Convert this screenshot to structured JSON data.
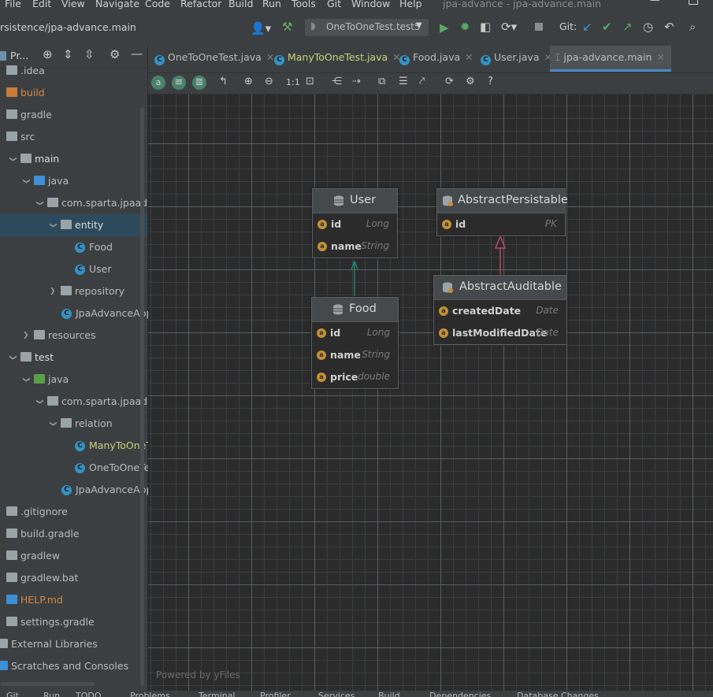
{
  "menu": {
    "items": [
      "File",
      "Edit",
      "View",
      "Navigate",
      "Code",
      "Refactor",
      "Build",
      "Run",
      "Tools",
      "Git",
      "Window",
      "Help"
    ],
    "window_title": "jpa-advance - jpa-advance.main"
  },
  "toolbar": {
    "breadcrumb": "rsistence/jpa-advance.main",
    "run_config": "OneToOneTest.test5",
    "git_label": "Git:"
  },
  "project": {
    "header": "Pr...",
    "tree": [
      {
        "label": ".idea",
        "kind": "folder-gray"
      },
      {
        "label": "build",
        "kind": "folder-orange"
      },
      {
        "label": "gradle",
        "kind": "folder-gray"
      },
      {
        "label": "src",
        "kind": "folder-gray"
      },
      {
        "label": "main",
        "kind": "folder-module"
      },
      {
        "label": "java",
        "kind": "folder-blue"
      },
      {
        "label": "com.sparta.jpaadvan",
        "kind": "package"
      },
      {
        "label": "entity",
        "kind": "package"
      },
      {
        "label": "Food",
        "kind": "class"
      },
      {
        "label": "User",
        "kind": "class"
      },
      {
        "label": "repository",
        "kind": "package"
      },
      {
        "label": "JpaAdvanceAppli",
        "kind": "app"
      },
      {
        "label": "resources",
        "kind": "folder-res"
      },
      {
        "label": "test",
        "kind": "folder-module"
      },
      {
        "label": "java",
        "kind": "folder-green"
      },
      {
        "label": "com.sparta.jpaadvan",
        "kind": "package"
      },
      {
        "label": "relation",
        "kind": "package"
      },
      {
        "label": "ManyToOneTe",
        "kind": "class-test"
      },
      {
        "label": "OneToOneTes",
        "kind": "class-test2"
      },
      {
        "label": "JpaAdvanceAppli",
        "kind": "app"
      },
      {
        "label": ".gitignore",
        "kind": "file"
      },
      {
        "label": "build.gradle",
        "kind": "gradle"
      },
      {
        "label": "gradlew",
        "kind": "file"
      },
      {
        "label": "gradlew.bat",
        "kind": "file"
      },
      {
        "label": "HELP.md",
        "kind": "md"
      },
      {
        "label": "settings.gradle",
        "kind": "gradle"
      },
      {
        "label": "External Libraries",
        "kind": "lib"
      },
      {
        "label": "Scratches and Consoles",
        "kind": "scratch"
      }
    ]
  },
  "tabs": [
    {
      "label": "OneToOneTest.java",
      "color": "#bbbbbb"
    },
    {
      "label": "ManyToOneTest.java",
      "color": "#c7d17a"
    },
    {
      "label": "Food.java",
      "color": "#bbbbbb"
    },
    {
      "label": "User.java",
      "color": "#bbbbbb"
    },
    {
      "label": "jpa-advance.main",
      "color": "#bbbbbb"
    }
  ],
  "diagram": {
    "nodes": {
      "user": {
        "title": "User",
        "fields": [
          {
            "name": "id",
            "type": "Long"
          },
          {
            "name": "name",
            "type": "String"
          }
        ]
      },
      "food": {
        "title": "Food",
        "fields": [
          {
            "name": "id",
            "type": "Long"
          },
          {
            "name": "name",
            "type": "String"
          },
          {
            "name": "price",
            "type": "double"
          }
        ]
      },
      "abstract_persistable": {
        "title": "AbstractPersistable",
        "fields": [
          {
            "name": "id",
            "type": "PK"
          }
        ]
      },
      "abstract_auditable": {
        "title": "AbstractAuditable",
        "fields": [
          {
            "name": "createdDate",
            "type": "Date"
          },
          {
            "name": "lastModifiedDate",
            "type": "Date"
          }
        ]
      }
    },
    "watermark": "Powered by yFiles"
  },
  "statusbar": [
    "Git",
    "Run",
    "TODO",
    "Problems",
    "Terminal",
    "Profiler",
    "Services",
    "Build",
    "Dependencies",
    "Database Changes"
  ]
}
